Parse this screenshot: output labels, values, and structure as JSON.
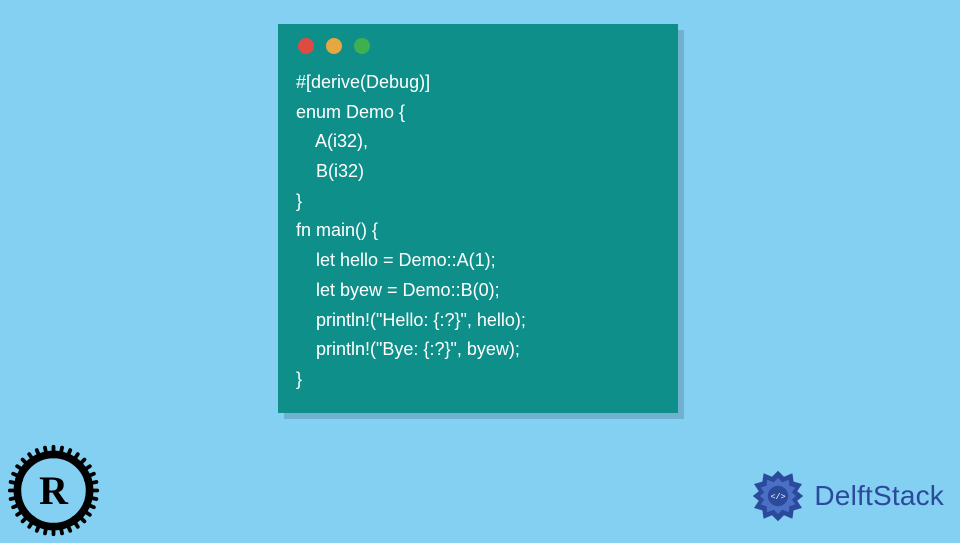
{
  "code_window": {
    "traffic_lights": [
      "red",
      "yellow",
      "green"
    ],
    "code": "#[derive(Debug)]\nenum Demo {\n    A(i32),\n    B(i32)\n}\nfn main() {\n    let hello = Demo::A(1);\n    let byew = Demo::B(0);\n    println!(\"Hello: {:?}\", hello);\n    println!(\"Bye: {:?}\", byew);\n}"
  },
  "logos": {
    "rust_alt": "Rust language logo",
    "brand_name": "DelftStack"
  }
}
